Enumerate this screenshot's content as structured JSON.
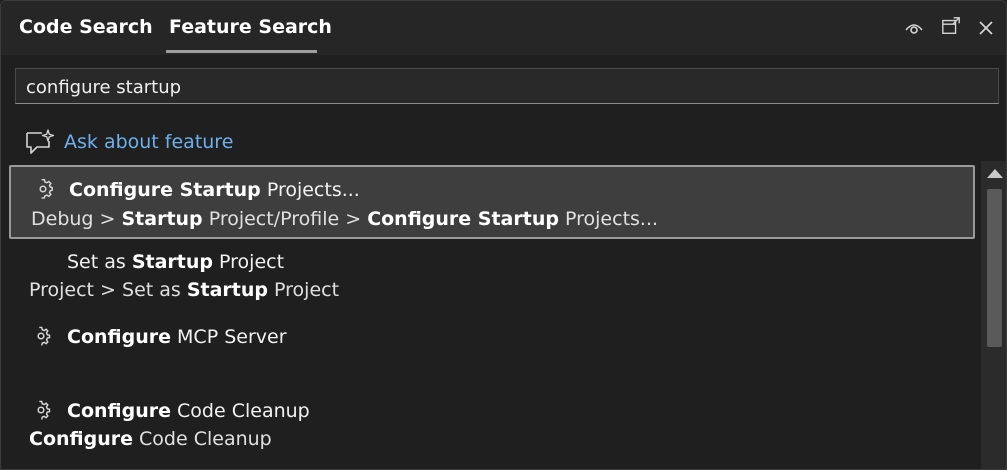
{
  "header": {
    "tabs": [
      {
        "label": "Code Search",
        "active": false
      },
      {
        "label": "Feature Search",
        "active": true
      }
    ],
    "icons": [
      "eye-icon",
      "popout-icon",
      "close-icon"
    ]
  },
  "search": {
    "value": "configure startup"
  },
  "ask": {
    "label": "Ask about feature",
    "icon": "chat-sparkle-icon",
    "color": "#6eb0ec"
  },
  "results": [
    {
      "icon": "gear-icon",
      "selected": true,
      "title": {
        "b1": "Configure Startup",
        "rest": " Projects..."
      },
      "path": {
        "p1": "Debug > ",
        "b1": "Startup",
        "p2": " Project/Profile > ",
        "b2": "Configure Startup",
        "p3": " Projects..."
      }
    },
    {
      "icon": null,
      "selected": false,
      "title": {
        "pre": "Set as ",
        "b1": "Startup",
        "rest": " Project"
      },
      "path": {
        "p1": "Project > Set as ",
        "b1": "Startup",
        "p2": " Project"
      }
    },
    {
      "icon": "gear-icon",
      "selected": false,
      "title": {
        "b1": "Configure",
        "rest": " MCP Server"
      },
      "path": null
    },
    {
      "icon": "gear-icon",
      "selected": false,
      "title": {
        "b1": "Configure",
        "rest": " Code Cleanup"
      },
      "path": {
        "b1": "Configure",
        "p1": " Code Cleanup"
      }
    }
  ]
}
